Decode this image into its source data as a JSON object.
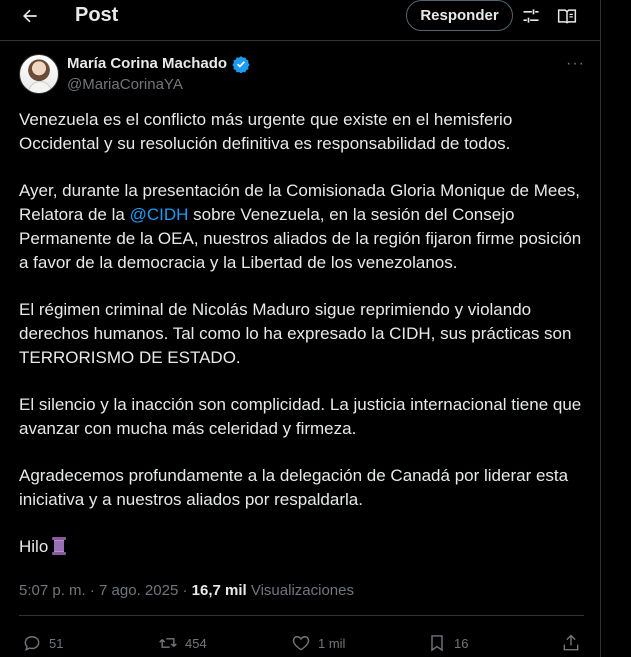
{
  "header": {
    "title": "Post",
    "reply_label": "Responder"
  },
  "author": {
    "name": "María Corina Machado",
    "handle": "@MariaCorinaYA"
  },
  "post": {
    "p1": "Venezuela es el conflicto más urgente que existe en el hemisferio Occidental y su resolución definitiva es responsabilidad de todos.",
    "p2_before": "Ayer, durante la presentación de la Comisionada Gloria Monique de Mees, Relatora de la ",
    "p2_mention": "@CIDH",
    "p2_after": " sobre Venezuela, en la sesión del Consejo Permanente de la OEA, nuestros aliados de la región fijaron firme posición a favor de la democracia y la Libertad de los venezolanos.",
    "p3": "El régimen criminal de Nicolás Maduro sigue reprimiendo y violando derechos humanos. Tal como lo ha expresado la CIDH, sus prácticas son TERRORISMO DE ESTADO.",
    "p4": "El silencio y la inacción son complicidad. La justicia internacional tiene que avanzar con mucha más celeridad y firmeza.",
    "p5": "Agradecemos profundamente a la delegación de Canadá por liderar esta iniciativa y a nuestros aliados por respaldarla.",
    "p6": "Hilo",
    "thread_icon": "thread-spool-emoji-icon"
  },
  "meta": {
    "time": "5:07 p. m.",
    "separator": " · ",
    "date": "7 ago. 2025",
    "views_count": "16,7 mil",
    "views_label": "Visualizaciones"
  },
  "actions": {
    "replies": "51",
    "reposts": "454",
    "likes": "1 mil",
    "bookmarks": "16"
  },
  "colors": {
    "background": "#000000",
    "text": "#e7e9ea",
    "muted": "#71767b",
    "accent": "#1d9bf0",
    "border": "#2f3336"
  }
}
